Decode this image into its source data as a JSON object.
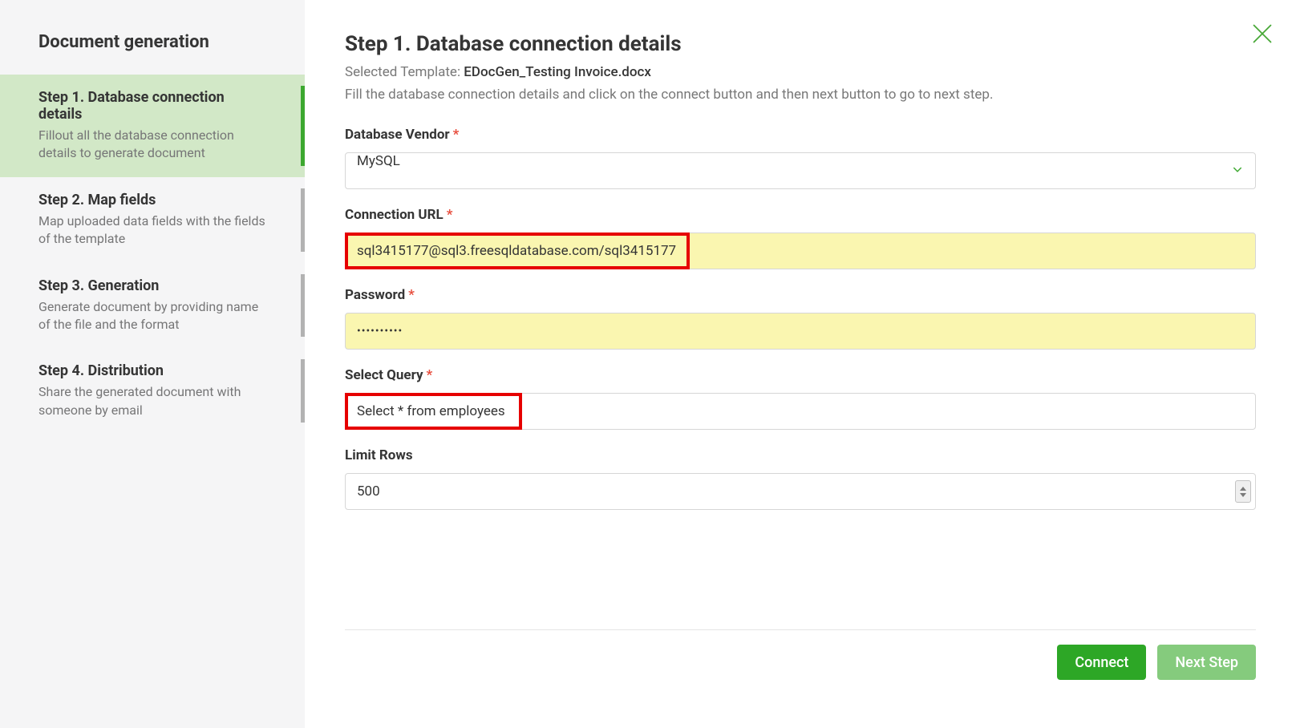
{
  "sidebar": {
    "title": "Document generation",
    "steps": [
      {
        "title": "Step 1. Database connection details",
        "desc": "Fillout all the database connection details to generate document"
      },
      {
        "title": "Step 2. Map fields",
        "desc": "Map uploaded data fields with the fields of the template"
      },
      {
        "title": "Step 3. Generation",
        "desc": "Generate document by providing name of the file and the format"
      },
      {
        "title": "Step 4. Distribution",
        "desc": "Share the generated document with someone by email"
      }
    ]
  },
  "main": {
    "title": "Step 1. Database connection details",
    "selectedTemplateLabel": "Selected Template: ",
    "selectedTemplateName": "EDocGen_Testing Invoice.docx",
    "instruction": "Fill the database connection details and click on the connect button and then next button to go to next step.",
    "form": {
      "vendorLabel": "Database Vendor",
      "vendorValue": "MySQL",
      "urlLabel": "Connection URL",
      "urlValue": "sql3415177@sql3.freesqldatabase.com/sql3415177",
      "passwordLabel": "Password",
      "passwordValue": "••••••••••",
      "queryLabel": "Select Query",
      "queryValue": "Select * from employees",
      "limitLabel": "Limit Rows",
      "limitValue": "500"
    },
    "buttons": {
      "connect": "Connect",
      "next": "Next Step"
    }
  }
}
